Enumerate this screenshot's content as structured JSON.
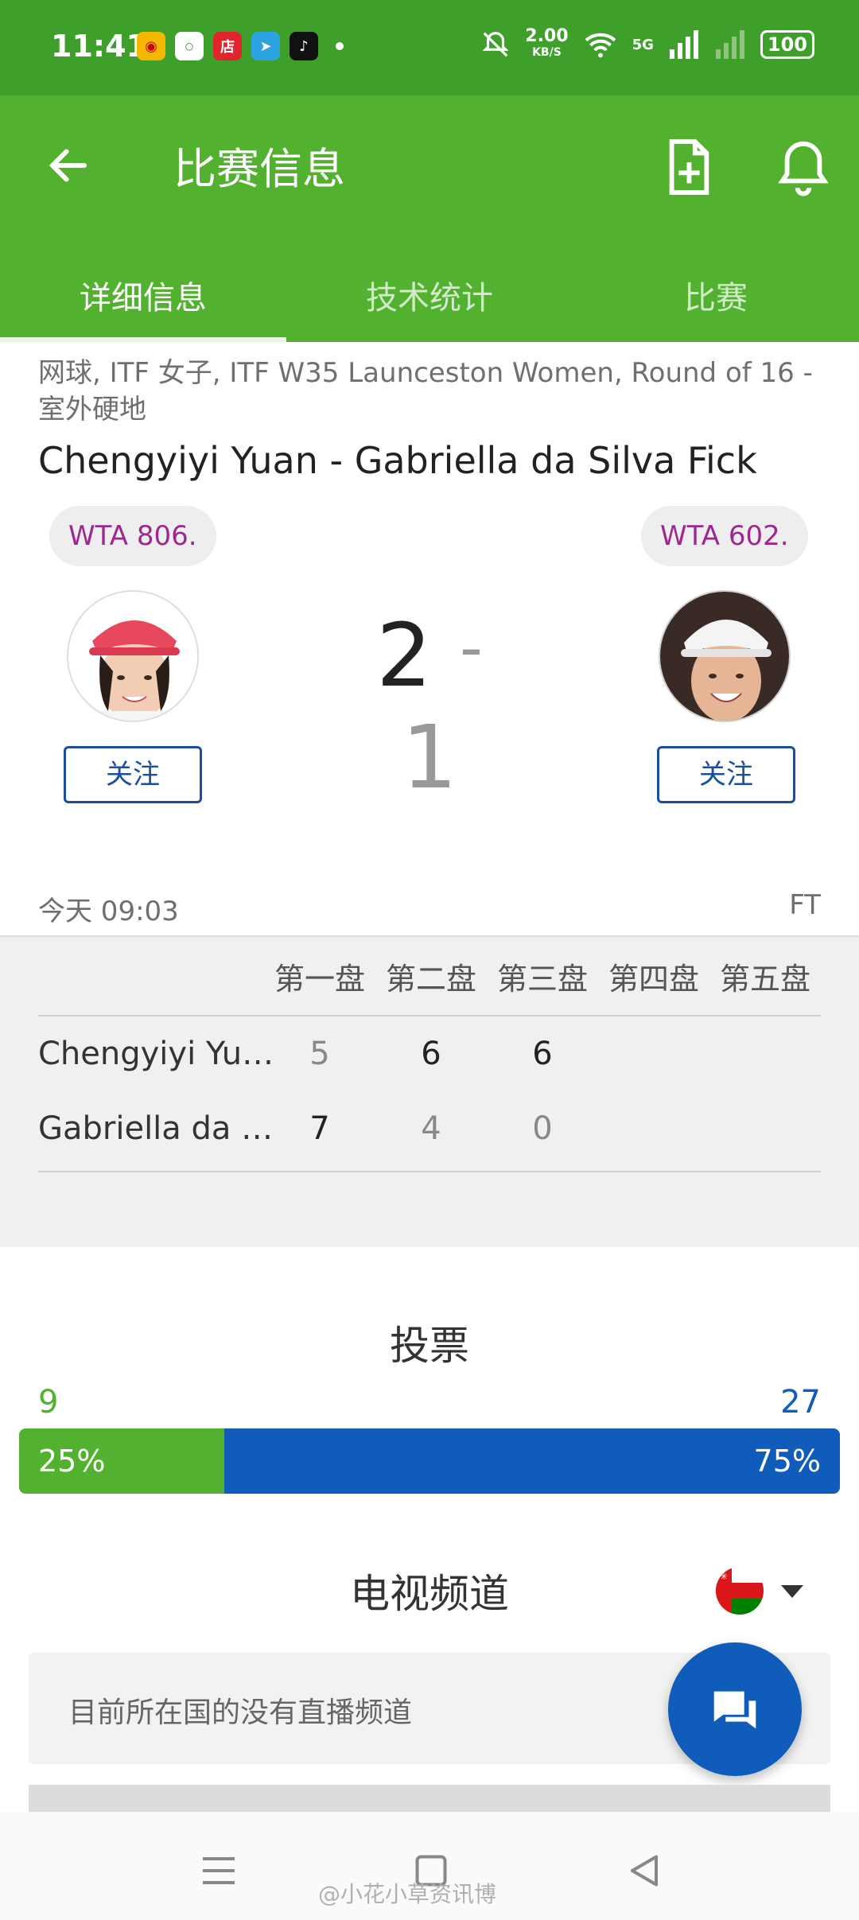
{
  "status_bar": {
    "time": "11:41",
    "speed_value": "2.00",
    "speed_unit": "KB/S",
    "network": "5G",
    "battery": "100"
  },
  "app_bar": {
    "title": "比赛信息"
  },
  "tabs": [
    {
      "label": "详细信息",
      "active": true
    },
    {
      "label": "技术统计",
      "active": false
    },
    {
      "label": "比赛",
      "active": false
    }
  ],
  "match": {
    "meta_line": "网球, ITF 女子, ITF W35 Launceston Women, Round of 16 - 室外硬地",
    "title": "Chengyiyi Yuan - Gabriella da Silva Fick",
    "home": {
      "rank": "WTA 806.",
      "follow_label": "关注",
      "short_name": "Chengyiyi Yu…"
    },
    "away": {
      "rank": "WTA 602.",
      "follow_label": "关注",
      "short_name": "Gabriella da …"
    },
    "score_home": "2",
    "score_sep": "-",
    "score_away": "1",
    "time": "今天 09:03",
    "status": "FT"
  },
  "sets": {
    "headers": [
      "第一盘",
      "第二盘",
      "第三盘",
      "第四盘",
      "第五盘"
    ],
    "home": [
      "5",
      "6",
      "6"
    ],
    "away": [
      "7",
      "4",
      "0"
    ]
  },
  "vote": {
    "title": "投票",
    "home_count": "9",
    "away_count": "27",
    "home_pct_label": "25%",
    "away_pct_label": "75%",
    "home_fraction": 0.25
  },
  "tv": {
    "title": "电视频道",
    "message": "目前所在国的没有直播频道"
  },
  "watermark": "@小花小草资讯博",
  "colors": {
    "brand_green": "#52b12f",
    "vote_blue": "#0f5cba",
    "rank_purple": "#9b2a8f"
  }
}
